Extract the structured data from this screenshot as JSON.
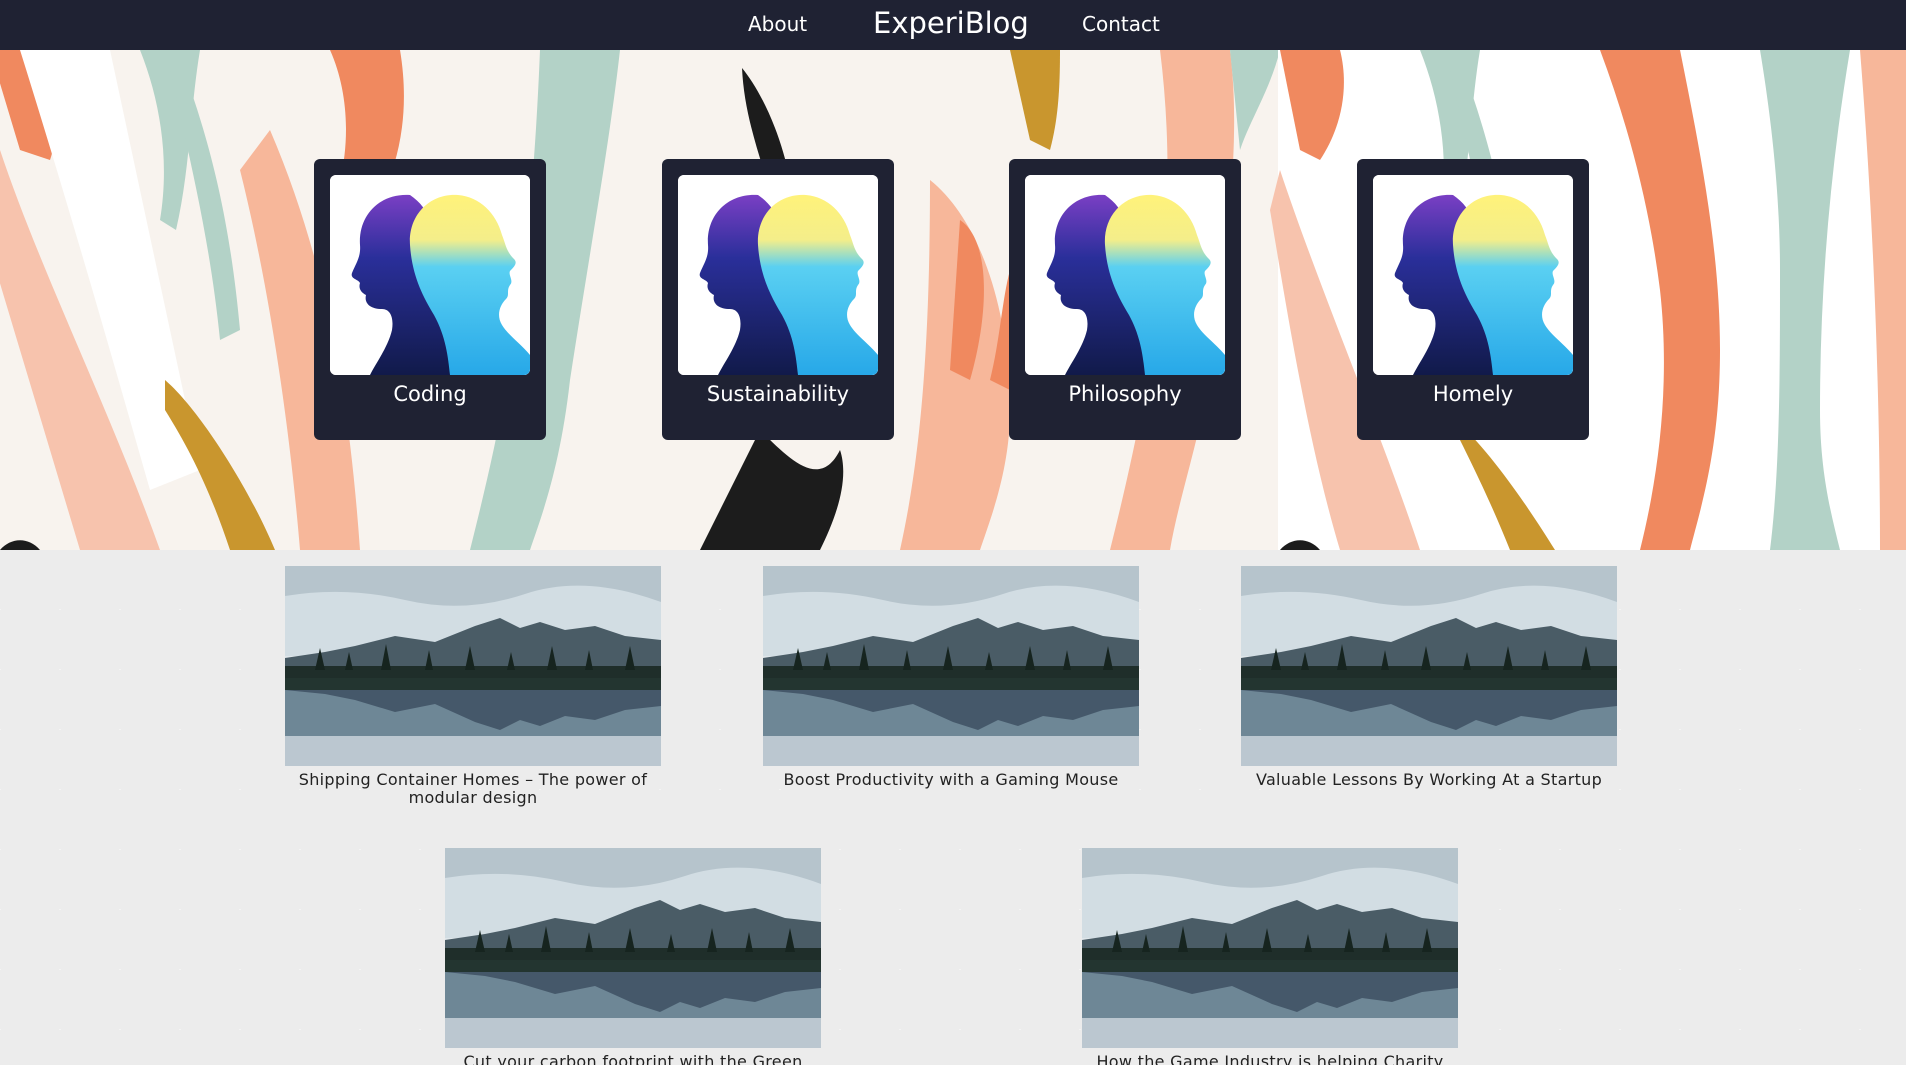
{
  "nav": {
    "about": "About",
    "brand": "ExperiBlog",
    "contact": "Contact"
  },
  "hero": {
    "image_icon": "two-heads-watercolor-image",
    "categories": [
      {
        "label": "Coding"
      },
      {
        "label": "Sustainability"
      },
      {
        "label": "Philosophy"
      },
      {
        "label": "Homely"
      }
    ]
  },
  "posts": {
    "image_icon": "mountain-lake-image",
    "items": [
      {
        "title": "Shipping Container Homes – The power of modular design"
      },
      {
        "title": "Boost Productivity with a Gaming Mouse"
      },
      {
        "title": "Valuable Lessons By Working At a Startup"
      },
      {
        "title": "Cut your carbon footprint with the Green"
      },
      {
        "title": "How the Game Industry is helping Charity"
      }
    ]
  },
  "colors": {
    "nav_bg": "#1f2233",
    "card_bg": "#1f2233",
    "hero_bg": "#f8f3ee",
    "stroke_orange": "#f0895f",
    "stroke_peach": "#f7b79a",
    "stroke_sage": "#b3d2c7",
    "stroke_gold": "#c9962e",
    "stroke_black": "#1c1c1c"
  }
}
